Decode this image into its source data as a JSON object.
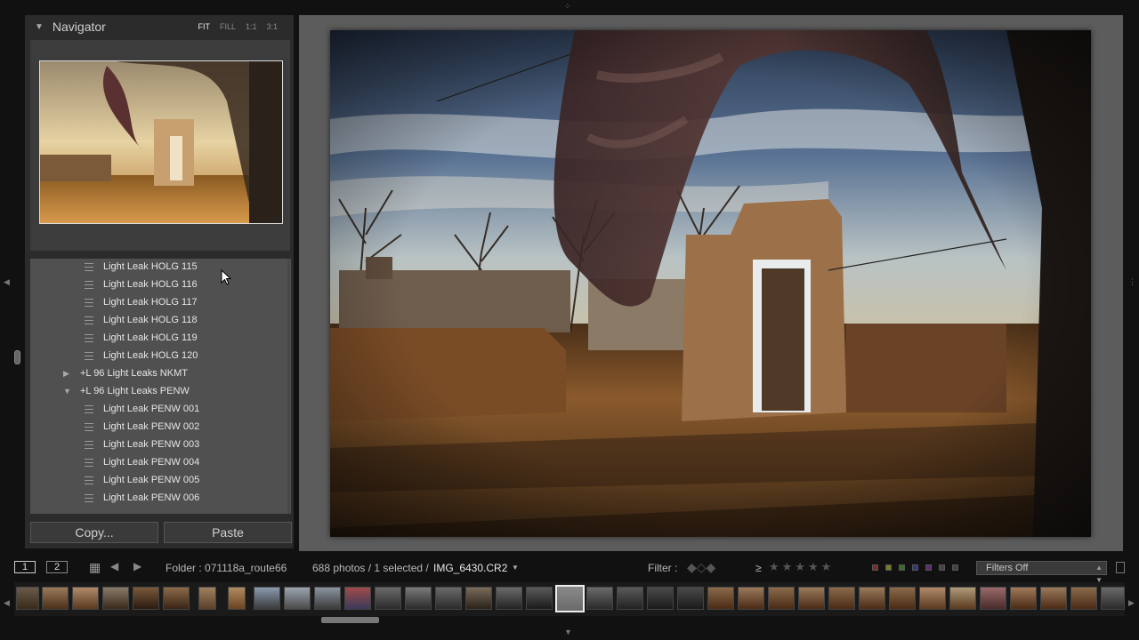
{
  "navigator": {
    "title": "Navigator",
    "zoom_options": [
      "FIT",
      "FILL",
      "1:1",
      "3:1"
    ],
    "active_zoom": "FIT"
  },
  "presets": [
    {
      "type": "preset",
      "label": "Light Leak HOLG 115"
    },
    {
      "type": "preset",
      "label": "Light Leak HOLG 116"
    },
    {
      "type": "preset",
      "label": "Light Leak HOLG 117"
    },
    {
      "type": "preset",
      "label": "Light Leak HOLG 118"
    },
    {
      "type": "preset",
      "label": "Light Leak HOLG 119"
    },
    {
      "type": "preset",
      "label": "Light Leak HOLG 120"
    },
    {
      "type": "folder",
      "label": "+L 96 Light Leaks NKMT",
      "expanded": false
    },
    {
      "type": "folder",
      "label": "+L 96 Light Leaks PENW",
      "expanded": true
    },
    {
      "type": "preset",
      "label": "Light Leak PENW 001"
    },
    {
      "type": "preset",
      "label": "Light Leak PENW 002"
    },
    {
      "type": "preset",
      "label": "Light Leak PENW 003"
    },
    {
      "type": "preset",
      "label": "Light Leak PENW 004"
    },
    {
      "type": "preset",
      "label": "Light Leak PENW 005"
    },
    {
      "type": "preset",
      "label": "Light Leak PENW 006"
    }
  ],
  "buttons": {
    "copy": "Copy...",
    "paste": "Paste"
  },
  "toolbar": {
    "view1": "1",
    "view2": "2",
    "folder": "Folder : 071118a_route66",
    "count": "688 photos / 1 selected /",
    "filename": "IMG_6430.CR2",
    "filter_label": "Filter :",
    "filters_value": "Filters Off",
    "stars_op": "≥"
  },
  "colors": {
    "swatches": [
      "#7a2c2c",
      "#7a7a2c",
      "#3a6a2c",
      "#2c3a7a",
      "#5a2c6a",
      "#444444",
      "#444444"
    ]
  }
}
